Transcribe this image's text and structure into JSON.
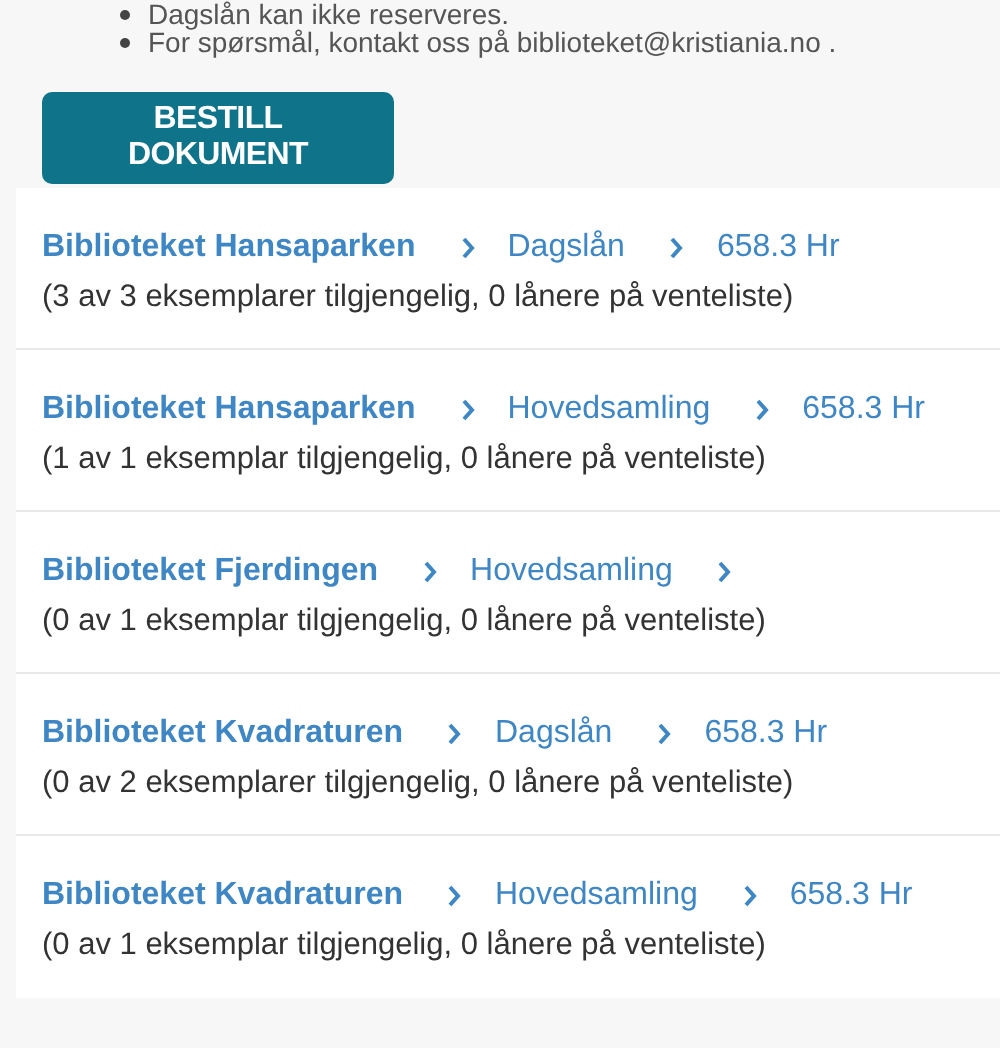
{
  "notes": [
    "Dagslån kan ikke reserveres.",
    "For spørsmål, kontakt oss på biblioteket@kristiania.no ."
  ],
  "order_button": {
    "label": "BESTILL DOKUMENT"
  },
  "holdings": [
    {
      "library": "Biblioteket Hansaparken",
      "collection": "Dagslån",
      "shelfmark": "658.3 Hr",
      "availability": "(3 av 3 eksemplarer tilgjengelig, 0 lånere på venteliste)"
    },
    {
      "library": "Biblioteket Hansaparken",
      "collection": "Hovedsamling",
      "shelfmark": "658.3 Hr",
      "availability": "(1 av 1 eksemplar tilgjengelig, 0 lånere på venteliste)"
    },
    {
      "library": "Biblioteket Fjerdingen",
      "collection": "Hovedsamling",
      "availability": "(0 av 1 eksemplar tilgjengelig, 0 lånere på venteliste)"
    },
    {
      "library": "Biblioteket Kvadraturen",
      "collection": "Dagslån",
      "shelfmark": "658.3 Hr",
      "availability": "(0 av 2 eksemplarer tilgjengelig, 0 lånere på venteliste)"
    },
    {
      "library": "Biblioteket Kvadraturen",
      "collection": "Hovedsamling",
      "shelfmark": "658.3 Hr",
      "availability": "(0 av 1 eksemplar tilgjengelig, 0 lånere på venteliste)"
    }
  ]
}
